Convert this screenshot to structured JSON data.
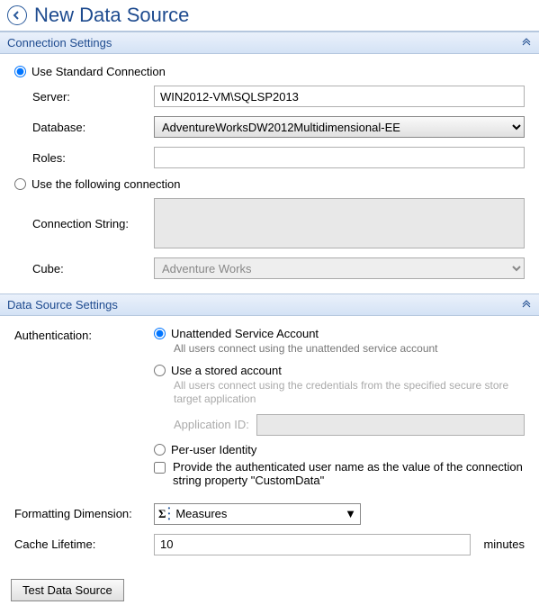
{
  "header": {
    "title": "New Data Source"
  },
  "sections": {
    "connection": {
      "title": "Connection Settings"
    },
    "dataSource": {
      "title": "Data Source Settings"
    }
  },
  "connection": {
    "useStandardLabel": "Use Standard Connection",
    "serverLabel": "Server:",
    "serverValue": "WIN2012-VM\\SQLSP2013",
    "databaseLabel": "Database:",
    "databaseValue": "AdventureWorksDW2012Multidimensional-EE",
    "rolesLabel": "Roles:",
    "rolesValue": "",
    "useFollowingLabel": "Use the following connection",
    "connStringLabel": "Connection String:",
    "connStringValue": "",
    "cubeLabel": "Cube:",
    "cubeValue": "Adventure Works"
  },
  "dataSource": {
    "authLabel": "Authentication:",
    "unattendedLabel": "Unattended Service Account",
    "unattendedDesc": "All users connect using the unattended service account",
    "storedLabel": "Use a stored account",
    "storedDesc": "All users connect using the credentials from the specified secure store target application",
    "appIdLabel": "Application ID:",
    "appIdValue": "",
    "perUserLabel": "Per-user Identity",
    "customDataLabel": "Provide the authenticated user name as the value of the connection string property \"CustomData\"",
    "formattingDimLabel": "Formatting Dimension:",
    "formattingDimValue": "Measures",
    "cacheLifetimeLabel": "Cache Lifetime:",
    "cacheLifetimeValue": "10",
    "cacheUnits": "minutes"
  },
  "buttons": {
    "test": "Test Data Source"
  }
}
